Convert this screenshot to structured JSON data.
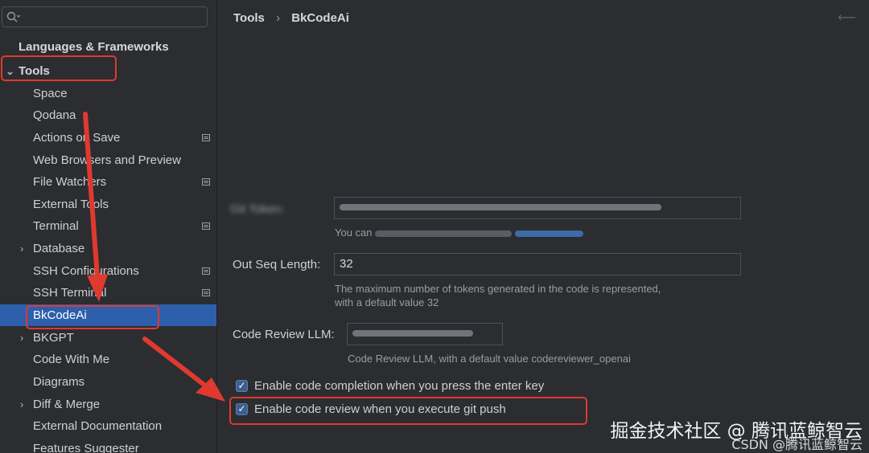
{
  "sidebar": {
    "search_placeholder": "",
    "items": [
      {
        "label": "Languages & Frameworks",
        "indent": 0
      },
      {
        "label": "Tools",
        "indent": 0,
        "expanded": true
      },
      {
        "label": "Space",
        "indent": 1
      },
      {
        "label": "Qodana",
        "indent": 1
      },
      {
        "label": "Actions on Save",
        "indent": 1
      },
      {
        "label": "Web Browsers and Preview",
        "indent": 1
      },
      {
        "label": "File Watchers",
        "indent": 1
      },
      {
        "label": "External Tools",
        "indent": 1
      },
      {
        "label": "Terminal",
        "indent": 1
      },
      {
        "label": "Database",
        "indent": 1,
        "expandable": true
      },
      {
        "label": "SSH Configurations",
        "indent": 1
      },
      {
        "label": "SSH Terminal",
        "indent": 1
      },
      {
        "label": "BkCodeAi",
        "indent": 1,
        "selected": true
      },
      {
        "label": "BKGPT",
        "indent": 1,
        "expandable": true
      },
      {
        "label": "Code With Me",
        "indent": 1
      },
      {
        "label": "Diagrams",
        "indent": 1
      },
      {
        "label": "Diff & Merge",
        "indent": 1,
        "expandable": true
      },
      {
        "label": "External Documentation",
        "indent": 1
      },
      {
        "label": "Features Suggester",
        "indent": 1
      }
    ]
  },
  "breadcrumb": {
    "parent": "Tools",
    "separator": "›",
    "current": "BkCodeAi"
  },
  "form": {
    "token_label": "Git Token:",
    "token_hint": "You can",
    "out_seq_label": "Out Seq Length:",
    "out_seq_value": "32",
    "out_seq_hint_line1": "The maximum number of tokens generated in the code is represented,",
    "out_seq_hint_line2": "with a default value 32",
    "review_llm_label": "Code Review LLM:",
    "review_llm_hint": "Code Review LLM, with a default value codereviewer_openai",
    "check_completion": "Enable code completion when you press the enter key",
    "check_review": "Enable code review when you execute git push"
  },
  "watermark": {
    "line1": "掘金技术社区 @ 腾讯蓝鲸智云",
    "line2": "CSDN @腾讯蓝鲸智云"
  },
  "colors": {
    "accent_selection": "#2e5fad",
    "annotation_red": "#e0392f"
  }
}
